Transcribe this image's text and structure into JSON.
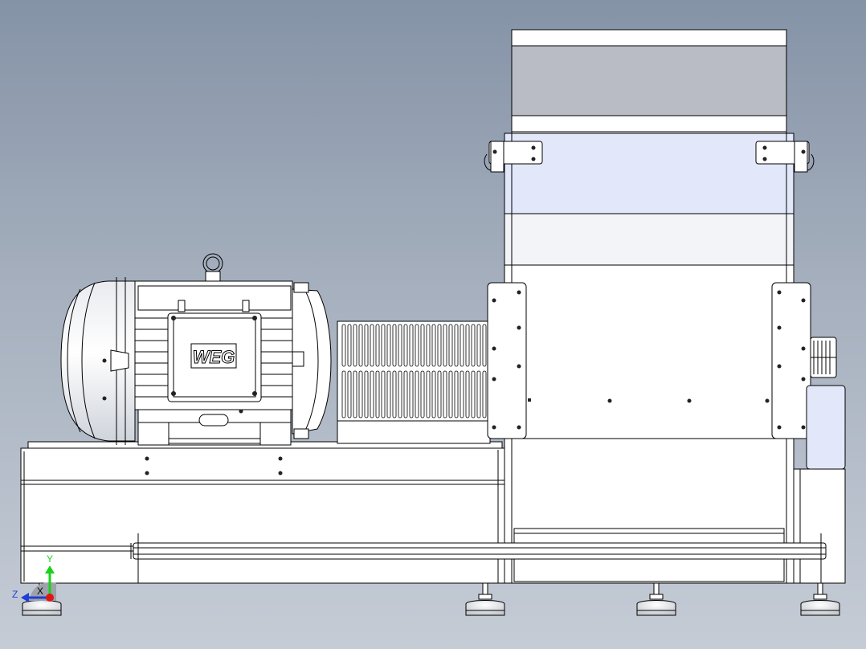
{
  "view": {
    "background_top": "#8593a7",
    "background_bottom": "#c5ccd6",
    "part_fill": "#ffffff",
    "highlight_fill": "#e2e8fa",
    "hopper_window_fill": "#b9bcc4"
  },
  "motor": {
    "brand_label": "WEG"
  },
  "triad": {
    "y_label": "Y",
    "z_label": "Z",
    "x_label": "X",
    "y_color": "#1bd11b",
    "z_color": "#1f3fd6",
    "x_color": "#e01515"
  }
}
